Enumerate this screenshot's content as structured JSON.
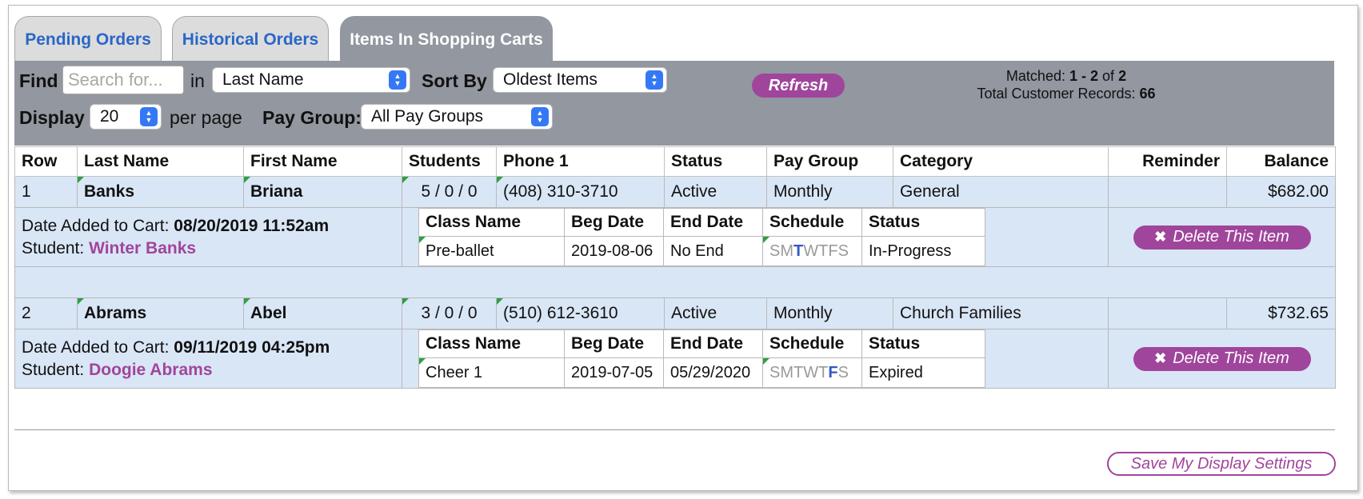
{
  "tabs": [
    {
      "label": "Pending Orders",
      "active": false
    },
    {
      "label": "Historical Orders",
      "active": false
    },
    {
      "label": "Items In Shopping Carts",
      "active": true
    }
  ],
  "toolbar": {
    "find_label": "Find",
    "search_placeholder": "Search for...",
    "in_label": "in",
    "search_field": "Last Name",
    "sort_label": "Sort By",
    "sort_value": "Oldest Items",
    "refresh_label": "Refresh",
    "matched_label": "Matched:",
    "matched_value": "1 - 2",
    "matched_of": "of",
    "matched_total": "2",
    "total_records_label": "Total Customer Records:",
    "total_records_value": "66",
    "display_label": "Display",
    "display_value": "20",
    "per_page_label": "per page",
    "pay_group_label": "Pay Group:",
    "pay_group_value": "All Pay Groups"
  },
  "table": {
    "headers": [
      "Row",
      "Last Name",
      "First Name",
      "Students",
      "Phone 1",
      "Status",
      "Pay Group",
      "Category",
      "Reminder",
      "Balance"
    ],
    "rows": [
      {
        "row": "1",
        "last_name": "Banks",
        "first_name": "Briana",
        "students": "5 / 0 / 0",
        "phone": "(408) 310-3710",
        "status": "Active",
        "pay_group": "Monthly",
        "category": "General",
        "reminder": "",
        "balance": "$682.00",
        "date_added_label": "Date Added to Cart:",
        "date_added": "08/20/2019 11:52am",
        "student_label": "Student:",
        "student_name": "Winter Banks",
        "class": {
          "name": "Pre-ballet",
          "beg": "2019-08-06",
          "end": "No End",
          "days": "SMTWTFS",
          "status": "In-Progress"
        },
        "active_day_index": 2,
        "delete_label": "Delete This Item"
      },
      {
        "row": "2",
        "last_name": "Abrams",
        "first_name": "Abel",
        "students": "3 / 0 / 0",
        "phone": "(510) 612-3610",
        "status": "Active",
        "pay_group": "Monthly",
        "category": "Church Families",
        "reminder": "",
        "balance": "$732.65",
        "date_added_label": "Date Added to Cart:",
        "date_added": "09/11/2019 04:25pm",
        "student_label": "Student:",
        "student_name": "Doogie Abrams",
        "class": {
          "name": "Cheer 1",
          "beg": "2019-07-05",
          "end": "05/29/2020",
          "days": "SMTWTFS",
          "status": "Expired"
        },
        "active_day_index": 5,
        "delete_label": "Delete This Item"
      }
    ],
    "sub_headers": [
      "Class Name",
      "Beg Date",
      "End Date",
      "Schedule",
      "Status"
    ]
  },
  "footer": {
    "save_label": "Save My Display Settings"
  },
  "icons": {
    "delete": "close-x-icon",
    "select": "select-chevron-icon"
  },
  "colors": {
    "accent": "#a0459c",
    "toolbar": "#9297a0",
    "row_bg": "#d9e6f6",
    "tab_link": "#2a66c8",
    "day_on": "#3058c8"
  }
}
